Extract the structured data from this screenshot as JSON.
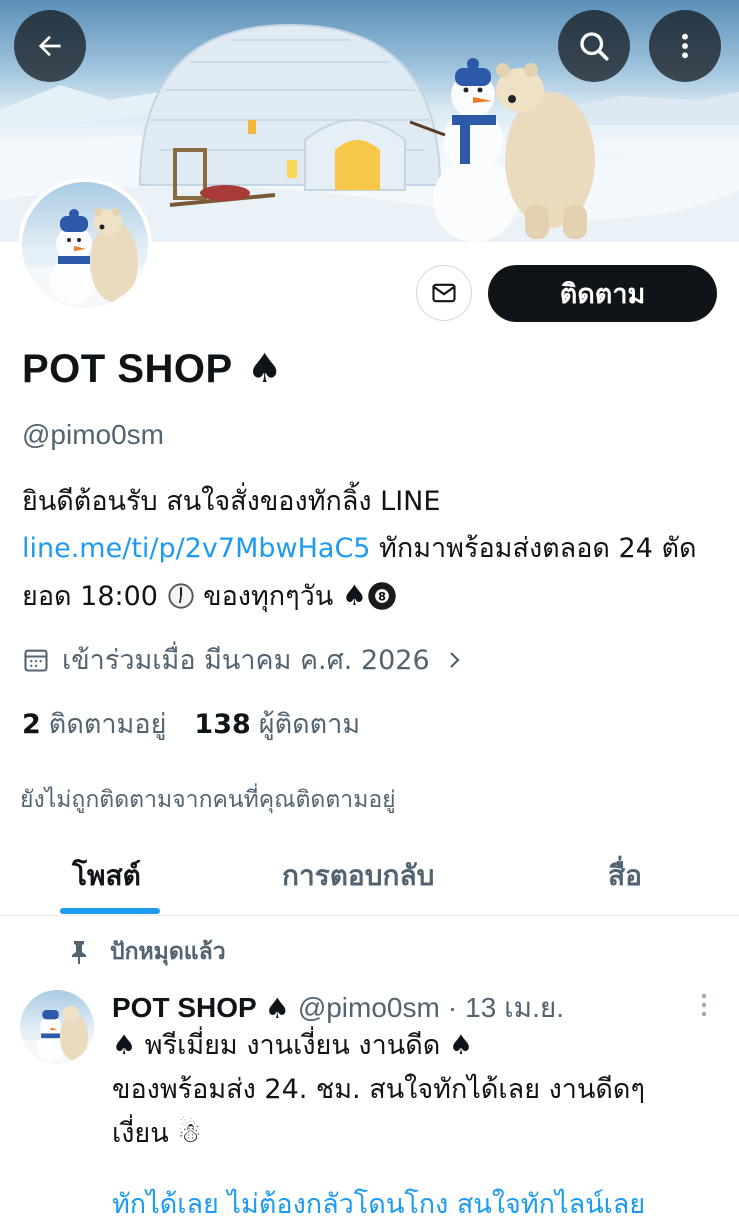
{
  "profile": {
    "display_name": "POT SHOP",
    "name_emoji": "♠",
    "handle": "@pimo0sm",
    "bio_text_1": "ยินดีต้อนรับ สนใจสั่งของทักลิ้ง LINE ",
    "bio_link": "line.me/ti/p/2v7MbwHaC5",
    "bio_text_2": " ทักมาพร้อมส่งตลอด 24 ตัดยอด 18:00 ",
    "bio_text_3": " ของทุกๆวัน ",
    "joined": "เข้าร่วมเมื่อ มีนาคม ค.ศ. 2026",
    "following_count": "2",
    "following_label": "ติดตามอยู่",
    "followers_count": "138",
    "followers_label": "ผู้ติดตาม",
    "not_followed_note": "ยังไม่ถูกติดตามจากคนที่คุณติดตามอยู่"
  },
  "actions": {
    "follow_label": "ติดตาม"
  },
  "tabs": [
    {
      "label": "โพสต์",
      "active": true
    },
    {
      "label": "การตอบกลับ",
      "active": false
    },
    {
      "label": "สื่อ",
      "active": false
    }
  ],
  "pinned_post": {
    "pinned_label": "ปักหมุดแล้ว",
    "author": "POT SHOP",
    "author_emoji": "♠",
    "handle": "@pimo0sm",
    "separator": "·",
    "date": "13 เม.ย.",
    "line_1": "♠ พรีเมี่ยม งานเงี่ยน งานดีด ♠",
    "line_2": "ของพร้อมส่ง 24. ชม. สนใจทักได้เลย งานดีดๆ",
    "line_3": "เงี่ยน ☃",
    "line_4_cut": "ทักได้เลย ไม่ต้องกลัวโดนโกง สนใจทักไลน์เลย"
  },
  "icons": {
    "back": "arrow-left-icon",
    "search": "search-icon",
    "more": "more-vertical-icon",
    "mail": "mail-icon",
    "calendar": "calendar-icon",
    "chevron": "chevron-right-icon",
    "pin": "pin-icon",
    "clock": "clock-icon",
    "eight_ball": "eight-ball-icon"
  },
  "colors": {
    "link": "#1d9bf0",
    "text": "#0f1419",
    "secondary": "#536471",
    "button": "#0f1419"
  }
}
